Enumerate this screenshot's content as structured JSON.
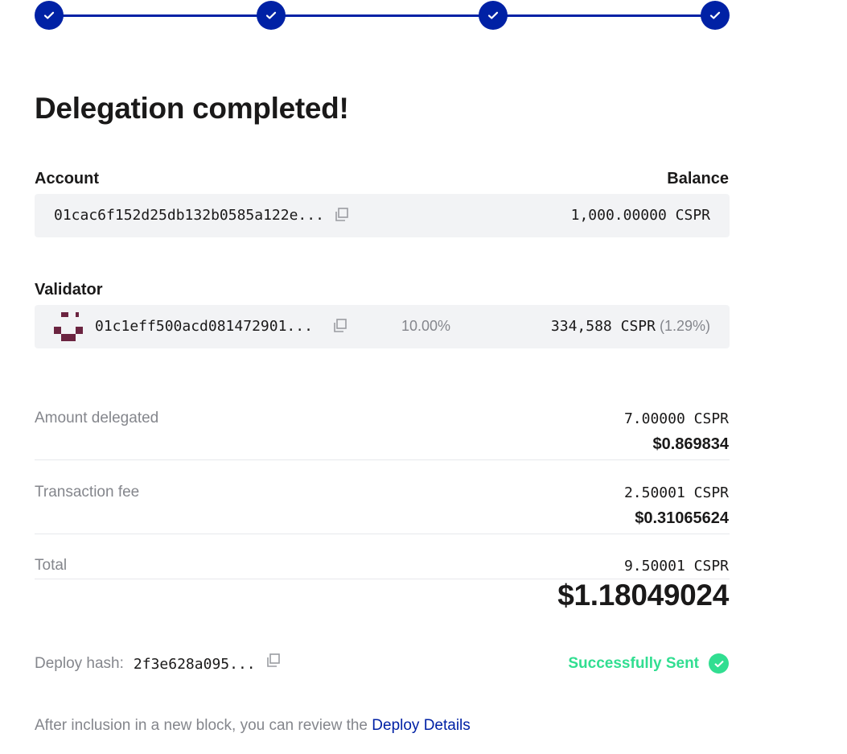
{
  "stepper": {
    "steps_total": 4,
    "steps_completed": 4,
    "accent_color": "#0021a5"
  },
  "page": {
    "title": "Delegation completed!"
  },
  "account": {
    "label": "Account",
    "balance_label": "Balance",
    "address": "01cac6f152d25db132b0585a122e...",
    "balance": "1,000.00000 CSPR"
  },
  "validator": {
    "label": "Validator",
    "address": "01c1eff500acd081472901...",
    "commission": "10.00%",
    "stake": "334,588 CSPR",
    "stake_share": "(1.29%)",
    "avatar_color": "#6b2440"
  },
  "summary": {
    "amount": {
      "label": "Amount delegated",
      "cspr": "7.00000 CSPR",
      "usd": "$0.869834"
    },
    "fee": {
      "label": "Transaction fee",
      "cspr": "2.50001 CSPR",
      "usd": "$0.31065624"
    },
    "total": {
      "label": "Total",
      "cspr": "9.50001 CSPR",
      "usd": "$1.18049024"
    }
  },
  "deploy": {
    "hash_label": "Deploy hash:",
    "hash": "2f3e628a095...",
    "status": "Successfully Sent",
    "status_color": "#31de91"
  },
  "footer": {
    "text": "After inclusion in a new block, you can review the",
    "link": "Deploy Details"
  }
}
